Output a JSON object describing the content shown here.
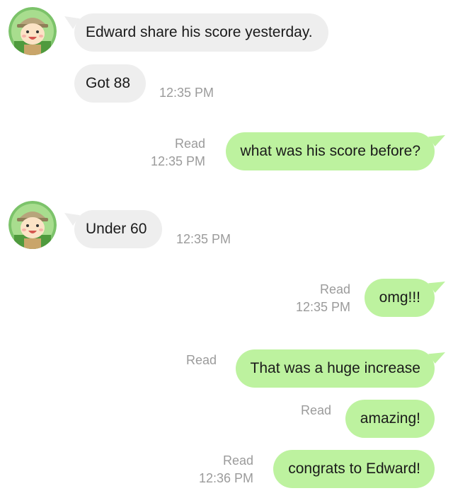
{
  "chat": {
    "messages": [
      {
        "side": "in",
        "avatar": "cartoon-boy-avatar",
        "text": "Edward share his score yesterday.",
        "time": ""
      },
      {
        "side": "in",
        "text": "Got 88",
        "time": "12:35 PM"
      },
      {
        "side": "out",
        "text": "what was his score before?",
        "status": "Read",
        "time": "12:35 PM"
      },
      {
        "side": "in",
        "avatar": "cartoon-boy-avatar",
        "text": "Under 60",
        "time": "12:35 PM"
      },
      {
        "side": "out",
        "text": "omg!!!",
        "status": "Read",
        "time": "12:35 PM"
      },
      {
        "side": "out",
        "text": "That was a huge increase",
        "status": "Read",
        "time": ""
      },
      {
        "side": "out",
        "text": "amazing!",
        "status": "Read",
        "time": ""
      },
      {
        "side": "out",
        "text": "congrats to Edward!",
        "status": "Read",
        "time": "12:36 PM"
      }
    ]
  },
  "colors": {
    "outgoing_bubble": "#bdf29f",
    "incoming_bubble": "#eeeeee",
    "meta_text": "#9b9b9b",
    "message_text": "#1a1a1a"
  }
}
